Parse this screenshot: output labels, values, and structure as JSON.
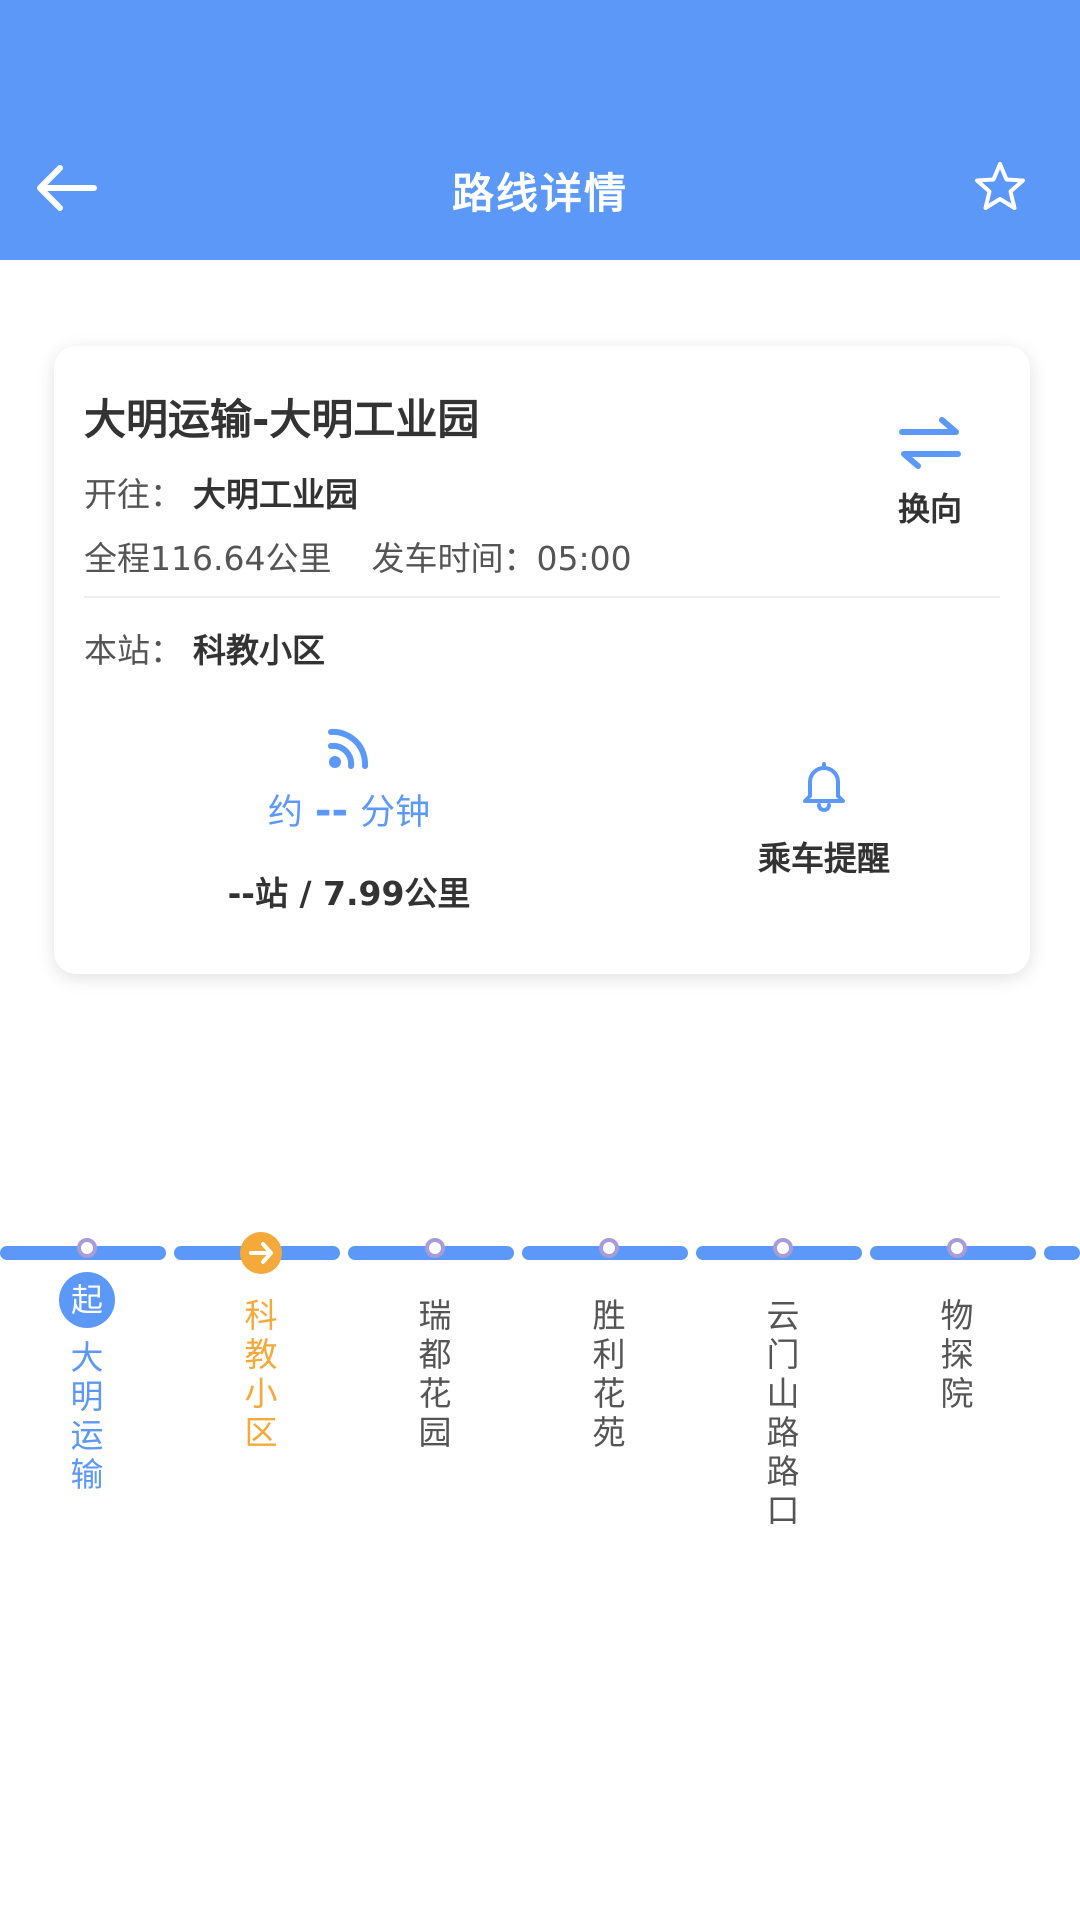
{
  "header": {
    "title": "路线详情",
    "back_icon": "arrow-left-icon",
    "fav_icon": "star-outline-icon"
  },
  "route": {
    "name": "大明运输-大明工业园",
    "dest_label": "开往：",
    "dest_value": "大明工业园",
    "distance_text": "全程116.64公里",
    "departure_text": "发车时间：05:00",
    "switch_label": "换向",
    "station_label": "本站：",
    "station_value": "科教小区"
  },
  "eta": {
    "prefix": "约",
    "value": "--",
    "unit": "分钟",
    "distance": "--站 / 7.99公里"
  },
  "remind": {
    "label": "乘车提醒"
  },
  "stops": [
    {
      "name": "大明运输",
      "badge": "起",
      "type": "first"
    },
    {
      "name": "科教小区",
      "type": "current"
    },
    {
      "name": "瑞都花园",
      "type": "normal"
    },
    {
      "name": "胜利花苑",
      "type": "normal"
    },
    {
      "name": "云门山路路口",
      "type": "normal"
    },
    {
      "name": "物探院",
      "type": "normal"
    }
  ],
  "colors": {
    "primary": "#5B98F8",
    "current": "#F5A93B",
    "dot_border": "#A79BD8"
  }
}
